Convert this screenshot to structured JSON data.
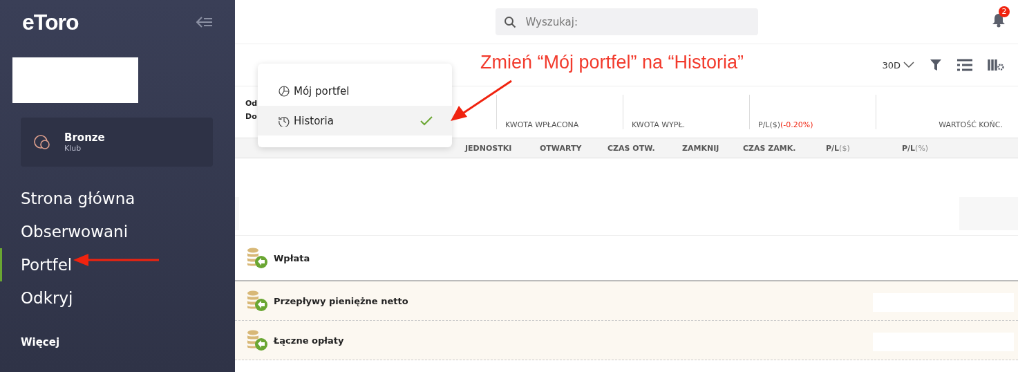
{
  "sidebar": {
    "logo": "eToro",
    "club": {
      "name": "Bronze",
      "label": "Klub"
    },
    "nav": [
      {
        "label": "Strona główna",
        "selected": false
      },
      {
        "label": "Obserwowani",
        "selected": false
      },
      {
        "label": "Portfel",
        "selected": true
      },
      {
        "label": "Odkryj",
        "selected": false
      }
    ],
    "more_heading": "Więcej"
  },
  "topbar": {
    "search": {
      "placeholder": "Wyszukaj:"
    },
    "notifications": "2"
  },
  "header": {
    "period": "30D"
  },
  "view_menu": [
    {
      "label": "Mój portfel",
      "kind": "portfolio",
      "selected": false
    },
    {
      "label": "Historia",
      "kind": "history",
      "selected": true
    }
  ],
  "annotation": "Zmień “Mój portfel” na “Historia”",
  "summary": {
    "dates": [
      "Od",
      "Do"
    ],
    "columns": [
      {
        "label": "KWOTA WPŁACONA"
      },
      {
        "label": "KWOTA WYPŁ."
      },
      {
        "label": "P/L($)",
        "change": "(-0.20%)"
      },
      {
        "label": "WARTOŚĆ KOŃC."
      }
    ]
  },
  "table": {
    "columns": [
      {
        "label": "JEDNOSTKI"
      },
      {
        "label": "OTWARTY"
      },
      {
        "label": "CZAS OTW."
      },
      {
        "label": "ZAMKNIJ"
      },
      {
        "label": "CZAS ZAMK."
      },
      {
        "label": "P/L",
        "suffix": "($)"
      },
      {
        "label": "P/L",
        "suffix": "(%)"
      }
    ]
  },
  "transactions": [
    {
      "label": "Wpłata",
      "kind": "plain"
    },
    {
      "label": "Przepływy pieniężne netto",
      "kind": "summary"
    },
    {
      "label": "Łączne opłaty",
      "kind": "summary"
    }
  ]
}
